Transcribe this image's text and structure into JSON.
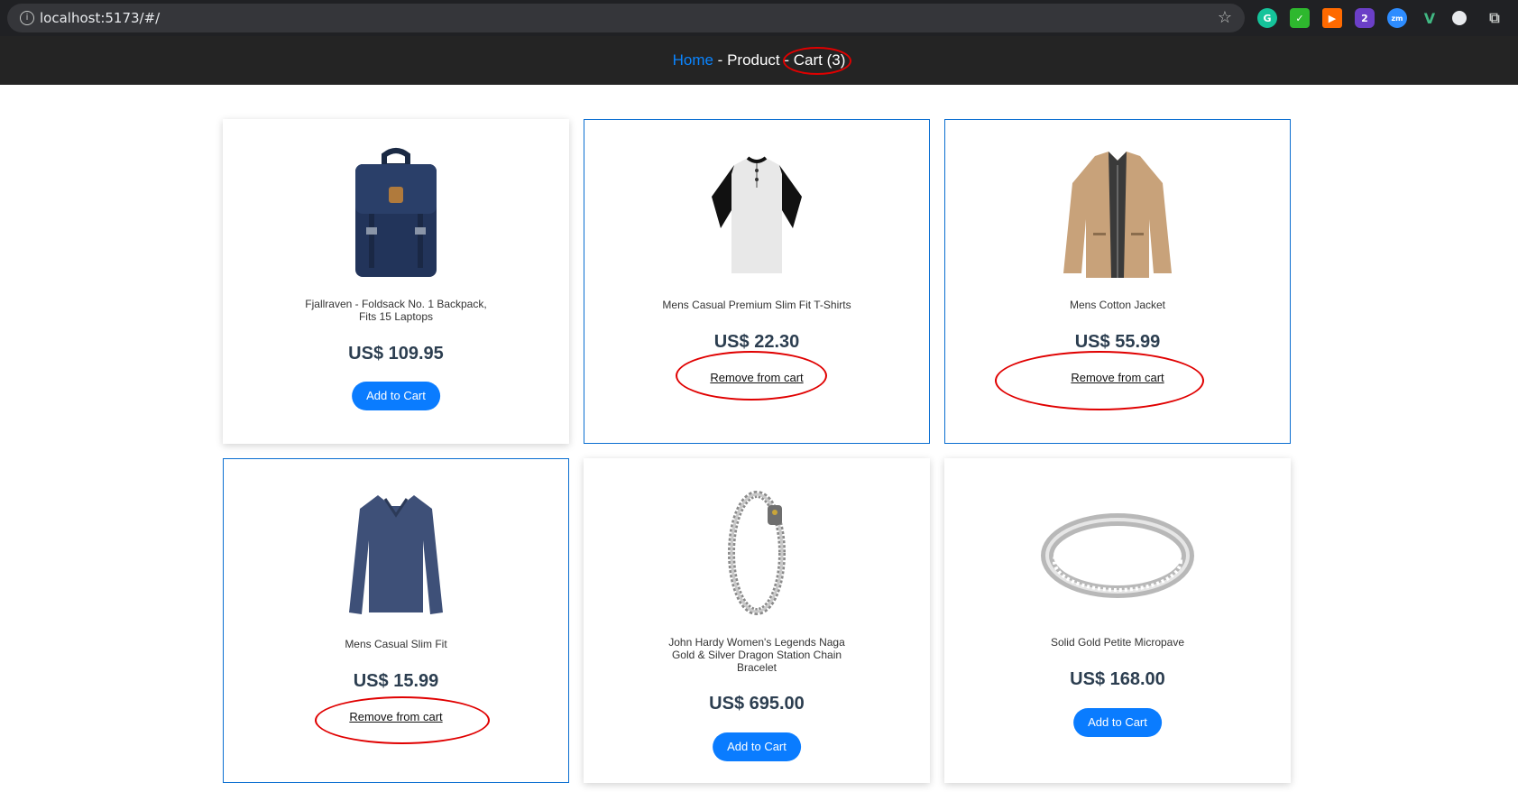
{
  "browser": {
    "url": "localhost:5173/#/",
    "extensions": [
      {
        "name": "grammarly",
        "glyph": "G",
        "color": "#15c39a"
      },
      {
        "name": "shield",
        "glyph": "✓",
        "color": "#2eb82e"
      },
      {
        "name": "ext-orange",
        "glyph": "▶",
        "color": "#ff6a00"
      },
      {
        "name": "ext-badge",
        "glyph": "2",
        "color": "#6b3fc7"
      },
      {
        "name": "zoom",
        "glyph": "zm",
        "color": "#2d8cff"
      },
      {
        "name": "vue",
        "glyph": "V",
        "color": "#41b883"
      },
      {
        "name": "profile",
        "glyph": "●",
        "color": "#e8eaed"
      },
      {
        "name": "puzzle",
        "glyph": "⧉",
        "color": "#c4c7c5"
      }
    ]
  },
  "nav": {
    "home": "Home",
    "sep1": " - ",
    "product": "Product",
    "sep2": " - ",
    "cart": "Cart (3)"
  },
  "products": [
    {
      "title": "Fjallraven - Foldsack No. 1 Backpack, Fits 15 Laptops",
      "price": "US$ 109.95",
      "action": "Add to Cart",
      "in_cart": false,
      "icon": "backpack-image"
    },
    {
      "title": "Mens Casual Premium Slim Fit T-Shirts",
      "price": "US$ 22.30",
      "action": "Remove from cart",
      "in_cart": true,
      "icon": "tshirt-image"
    },
    {
      "title": "Mens Cotton Jacket",
      "price": "US$ 55.99",
      "action": "Remove from cart",
      "in_cart": true,
      "icon": "jacket-image"
    },
    {
      "title": "Mens Casual Slim Fit",
      "price": "US$ 15.99",
      "action": "Remove from cart",
      "in_cart": true,
      "icon": "longsleeve-image"
    },
    {
      "title": "John Hardy Women's Legends Naga Gold & Silver Dragon Station Chain Bracelet",
      "price": "US$ 695.00",
      "action": "Add to Cart",
      "in_cart": false,
      "icon": "bracelet-image"
    },
    {
      "title": "Solid Gold Petite Micropave",
      "price": "US$ 168.00",
      "action": "Add to Cart",
      "in_cart": false,
      "icon": "ring-image"
    }
  ],
  "colors": {
    "accent": "#0a7cff",
    "annotation": "#e00000",
    "nav_bg": "#242424"
  }
}
